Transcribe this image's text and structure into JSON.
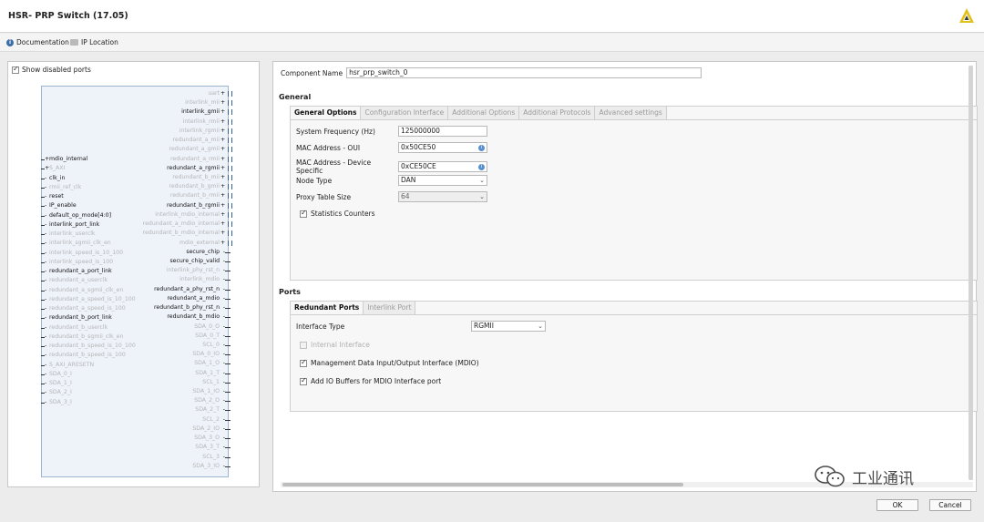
{
  "window": {
    "title": "HSR- PRP Switch (17.05)"
  },
  "toolbar": {
    "documentation": "Documentation",
    "ip_location": "IP Location"
  },
  "left_panel": {
    "show_disabled_ports": "Show disabled ports",
    "left_ports": [
      {
        "name": "mdio_internal",
        "enabled": true,
        "mark": "+"
      },
      {
        "name": "S_AXI",
        "enabled": false,
        "mark": "+"
      },
      {
        "name": "clk_in",
        "enabled": true,
        "mark": "-"
      },
      {
        "name": "rmii_ref_clk",
        "enabled": false,
        "mark": "-"
      },
      {
        "name": "reset",
        "enabled": true,
        "mark": "-"
      },
      {
        "name": "IP_enable",
        "enabled": true,
        "mark": "-"
      },
      {
        "name": "default_op_mode[4:0]",
        "enabled": true,
        "mark": "-"
      },
      {
        "name": "interlink_port_link",
        "enabled": true,
        "mark": "-"
      },
      {
        "name": "interlink_userclk",
        "enabled": false,
        "mark": "-"
      },
      {
        "name": "interlink_sgmii_clk_en",
        "enabled": false,
        "mark": "-"
      },
      {
        "name": "interlink_speed_is_10_100",
        "enabled": false,
        "mark": "-"
      },
      {
        "name": "interlink_speed_is_100",
        "enabled": false,
        "mark": "-"
      },
      {
        "name": "redundant_a_port_link",
        "enabled": true,
        "mark": "-"
      },
      {
        "name": "redundant_a_userclk",
        "enabled": false,
        "mark": "-"
      },
      {
        "name": "redundant_a_sgmii_clk_en",
        "enabled": false,
        "mark": "-"
      },
      {
        "name": "redundant_a_speed_is_10_100",
        "enabled": false,
        "mark": "-"
      },
      {
        "name": "redundant_a_speed_is_100",
        "enabled": false,
        "mark": "-"
      },
      {
        "name": "redundant_b_port_link",
        "enabled": true,
        "mark": "-"
      },
      {
        "name": "redundant_b_userclk",
        "enabled": false,
        "mark": "-"
      },
      {
        "name": "redundant_b_sgmii_clk_en",
        "enabled": false,
        "mark": "-"
      },
      {
        "name": "redundant_b_speed_is_10_100",
        "enabled": false,
        "mark": "-"
      },
      {
        "name": "redundant_b_speed_is_100",
        "enabled": false,
        "mark": "-"
      },
      {
        "name": "S_AXI_ARESETN",
        "enabled": false,
        "mark": "-"
      },
      {
        "name": "SDA_0_I",
        "enabled": false,
        "mark": "-"
      },
      {
        "name": "SDA_1_I",
        "enabled": false,
        "mark": "-"
      },
      {
        "name": "SDA_2_I",
        "enabled": false,
        "mark": "-"
      },
      {
        "name": "SDA_3_I",
        "enabled": false,
        "mark": "-"
      }
    ],
    "right_ports": [
      {
        "name": "uart",
        "enabled": false,
        "mark": "+",
        "bus": true
      },
      {
        "name": "interlink_mii",
        "enabled": false,
        "mark": "+",
        "bus": true
      },
      {
        "name": "interlink_gmii",
        "enabled": true,
        "mark": "+",
        "bus": true
      },
      {
        "name": "interlink_rmii",
        "enabled": false,
        "mark": "+",
        "bus": true
      },
      {
        "name": "interlink_rgmii",
        "enabled": false,
        "mark": "+",
        "bus": true
      },
      {
        "name": "redundant_a_mii",
        "enabled": false,
        "mark": "+",
        "bus": true
      },
      {
        "name": "redundant_a_gmii",
        "enabled": false,
        "mark": "+",
        "bus": true
      },
      {
        "name": "redundant_a_rmii",
        "enabled": false,
        "mark": "+",
        "bus": true
      },
      {
        "name": "redundant_a_rgmii",
        "enabled": true,
        "mark": "+",
        "bus": true
      },
      {
        "name": "redundant_b_mii",
        "enabled": false,
        "mark": "+",
        "bus": true
      },
      {
        "name": "redundant_b_gmii",
        "enabled": false,
        "mark": "+",
        "bus": true
      },
      {
        "name": "redundant_b_rmii",
        "enabled": false,
        "mark": "+",
        "bus": true
      },
      {
        "name": "redundant_b_rgmii",
        "enabled": true,
        "mark": "+",
        "bus": true
      },
      {
        "name": "interlink_mdio_internal",
        "enabled": false,
        "mark": "+",
        "bus": true
      },
      {
        "name": "redundant_a_mdio_internal",
        "enabled": false,
        "mark": "+",
        "bus": true
      },
      {
        "name": "redundant_b_mdio_internal",
        "enabled": false,
        "mark": "+",
        "bus": true
      },
      {
        "name": "mdio_external",
        "enabled": false,
        "mark": "+",
        "bus": true
      },
      {
        "name": "secure_chip",
        "enabled": true,
        "mark": "-",
        "bus": false
      },
      {
        "name": "secure_chip_valid",
        "enabled": true,
        "mark": "-",
        "bus": false
      },
      {
        "name": "interlink_phy_rst_n",
        "enabled": false,
        "mark": "-",
        "bus": false
      },
      {
        "name": "interlink_mdio",
        "enabled": false,
        "mark": "-",
        "bus": false
      },
      {
        "name": "redundant_a_phy_rst_n",
        "enabled": true,
        "mark": "-",
        "bus": false
      },
      {
        "name": "redundant_a_mdio",
        "enabled": true,
        "mark": "-",
        "bus": false
      },
      {
        "name": "redundant_b_phy_rst_n",
        "enabled": true,
        "mark": "-",
        "bus": false
      },
      {
        "name": "redundant_b_mdio",
        "enabled": true,
        "mark": "-",
        "bus": false
      },
      {
        "name": "SDA_0_O",
        "enabled": false,
        "mark": "-",
        "bus": false
      },
      {
        "name": "SDA_0_T",
        "enabled": false,
        "mark": "-",
        "bus": false
      },
      {
        "name": "SCL_0",
        "enabled": false,
        "mark": "-",
        "bus": false
      },
      {
        "name": "SDA_0_IO",
        "enabled": false,
        "mark": "-",
        "bus": false
      },
      {
        "name": "SDA_1_O",
        "enabled": false,
        "mark": "-",
        "bus": false
      },
      {
        "name": "SDA_1_T",
        "enabled": false,
        "mark": "-",
        "bus": false
      },
      {
        "name": "SCL_1",
        "enabled": false,
        "mark": "-",
        "bus": false
      },
      {
        "name": "SDA_1_IO",
        "enabled": false,
        "mark": "-",
        "bus": false
      },
      {
        "name": "SDA_2_O",
        "enabled": false,
        "mark": "-",
        "bus": false
      },
      {
        "name": "SDA_2_T",
        "enabled": false,
        "mark": "-",
        "bus": false
      },
      {
        "name": "SCL_2",
        "enabled": false,
        "mark": "-",
        "bus": false
      },
      {
        "name": "SDA_2_IO",
        "enabled": false,
        "mark": "-",
        "bus": false
      },
      {
        "name": "SDA_3_O",
        "enabled": false,
        "mark": "-",
        "bus": false
      },
      {
        "name": "SDA_3_T",
        "enabled": false,
        "mark": "-",
        "bus": false
      },
      {
        "name": "SCL_3",
        "enabled": false,
        "mark": "-",
        "bus": false
      },
      {
        "name": "SDA_3_IO",
        "enabled": false,
        "mark": "-",
        "bus": false
      }
    ]
  },
  "right_panel": {
    "component_name_label": "Component Name",
    "component_name_value": "hsr_prp_switch_0",
    "general": {
      "label": "General",
      "tabs": [
        "General Options",
        "Configuration Interface",
        "Additional Options",
        "Additional Protocols",
        "Advanced settings"
      ],
      "fields": {
        "system_frequency": {
          "label": "System Frequency (Hz)",
          "value": "125000000"
        },
        "mac_oui": {
          "label": "MAC Address - OUI",
          "value": "0x50CE50"
        },
        "mac_device": {
          "label": "MAC Address - Device Specific",
          "value": "0xCE50CE"
        },
        "node_type": {
          "label": "Node Type",
          "value": "DAN"
        },
        "proxy_table_size": {
          "label": "Proxy Table Size",
          "value": "64"
        }
      },
      "statistics_counters": "Statistics Counters"
    },
    "ports": {
      "label": "Ports",
      "tabs": [
        "Redundant Ports",
        "Interlink Port"
      ],
      "interface_type_label": "Interface Type",
      "interface_type_value": "RGMII",
      "internal_interface": "Internal Interface",
      "mdio": "Management Data Input/Output Interface (MDIO)",
      "io_buffers": "Add IO Buffers for MDIO Interface port"
    }
  },
  "buttons": {
    "ok": "OK",
    "cancel": "Cancel"
  },
  "watermark": {
    "text": "工业通讯"
  },
  "colors": {
    "accent": "#3a6ea5",
    "block_fill": "#eef3fa",
    "block_border": "#9db4cf",
    "logo": "#d9b300"
  }
}
